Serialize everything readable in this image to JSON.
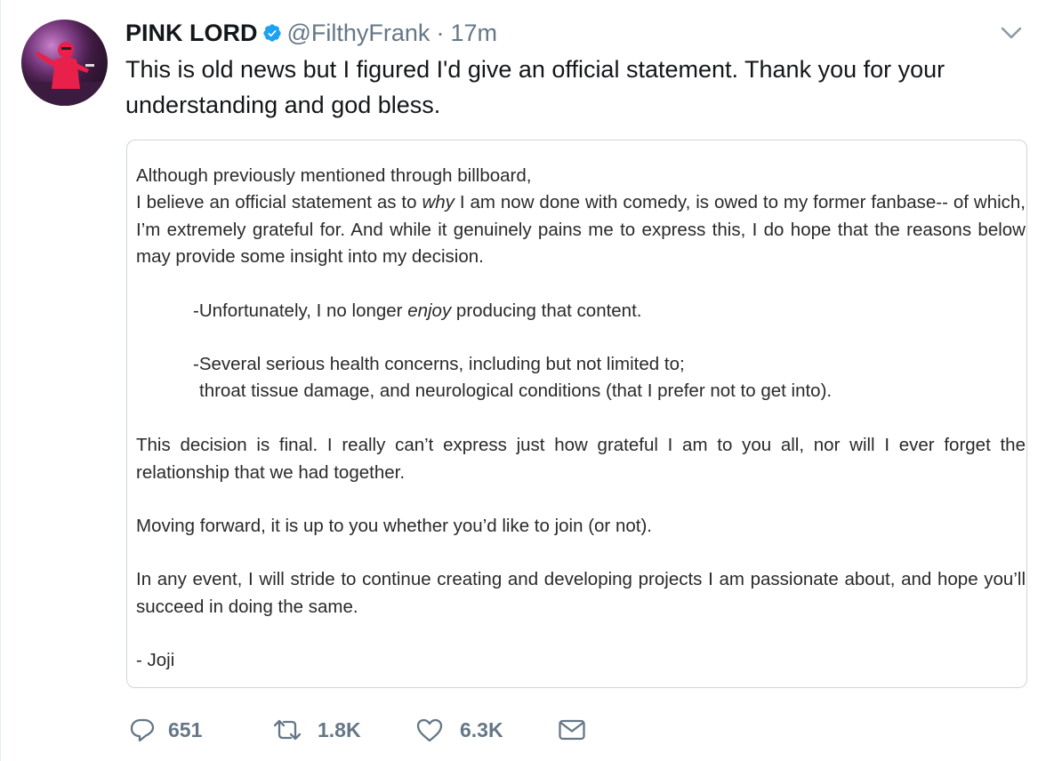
{
  "author": {
    "display_name": "PINK LORD",
    "handle": "@FilthyFrank",
    "separator": "·",
    "time": "17m",
    "verified": true
  },
  "tweet": {
    "text": "This is old news but I figured I'd give an official statement. Thank you for your understanding and god bless."
  },
  "statement": {
    "p1_line1": "Although previously mentioned through billboard,",
    "p1_rest_a": "I believe an official statement as to ",
    "p1_rest_em": "why",
    "p1_rest_b": " I am now done with comedy, is owed to my former fanbase-- of which, I’m extremely grateful for. And while it genuinely pains me to express this, I do hope that the reasons below may provide some insight into my decision.",
    "bullet1_a": "-Unfortunately, I no longer ",
    "bullet1_em": "enjoy",
    "bullet1_b": " producing that content.",
    "bullet2_line1": "-Several serious health concerns, including but not limited to;",
    "bullet2_line2": "throat tissue damage, and neurological conditions (that I prefer not to get into).",
    "p2": "This decision is final. I really can’t express just how grateful I am to you all, nor will I ever forget the relationship that we had together.",
    "p3": "Moving forward, it is up to you whether you’d like to join (or not).",
    "p4": "In any event, I will stride to continue creating and developing projects I am passionate about, and hope you’ll succeed in doing the same.",
    "signature": "- Joji"
  },
  "actions": {
    "reply_count": "651",
    "retweet_count": "1.8K",
    "like_count": "6.3K"
  },
  "icons": {
    "verified": "verified-badge-icon",
    "more": "chevron-down-icon",
    "reply": "reply-icon",
    "retweet": "retweet-icon",
    "like": "heart-icon",
    "dm": "envelope-icon"
  },
  "colors": {
    "verified_blue": "#1da1f2",
    "secondary_text": "#657786",
    "primary_text": "#14171a",
    "card_border": "#ccd6dd",
    "avatar_figure": "#e8204a"
  }
}
